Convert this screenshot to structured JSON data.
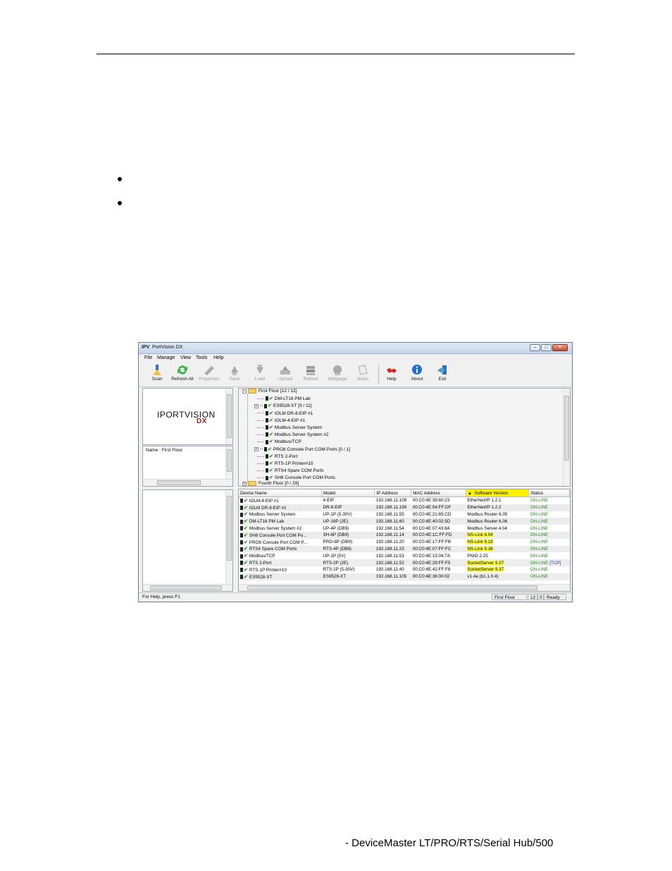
{
  "document": {
    "footer_text": "- DeviceMaster LT/PRO/RTS/Serial Hub/500"
  },
  "window": {
    "app_icon": "IPV",
    "title": "PortVision DX",
    "menu": [
      "File",
      "Manage",
      "View",
      "Tools",
      "Help"
    ],
    "toolbar": [
      {
        "label": "Scan",
        "icon": "scan-icon",
        "enabled": true
      },
      {
        "label": "Refresh All",
        "icon": "refresh-icon",
        "enabled": true
      },
      {
        "label": "Properties",
        "icon": "properties-icon",
        "enabled": false
      },
      {
        "label": "Save",
        "icon": "save-icon",
        "enabled": false
      },
      {
        "label": "Load",
        "icon": "load-icon",
        "enabled": false
      },
      {
        "label": "Upload",
        "icon": "upload-icon",
        "enabled": false
      },
      {
        "label": "Reboot",
        "icon": "reboot-icon",
        "enabled": false
      },
      {
        "label": "Webpage",
        "icon": "webpage-icon",
        "enabled": false
      },
      {
        "label": "Notes",
        "icon": "notes-icon",
        "enabled": false
      },
      {
        "label": "Help",
        "icon": "help-icon",
        "enabled": true
      },
      {
        "label": "About",
        "icon": "about-icon",
        "enabled": true
      },
      {
        "label": "Exit",
        "icon": "exit-icon",
        "enabled": true
      }
    ],
    "logo_text": "PORTVISION",
    "logo_prefix": "I",
    "logo_suffix": "DX",
    "properties_text": "Name : First Floor",
    "tree": {
      "root": "First Floor [12 / 12]",
      "children": [
        {
          "label": "DM-LT16 PM Lab",
          "expand": false
        },
        {
          "label": "ES9528-XT [9 / 11]",
          "expand": true
        },
        {
          "label": "IOLM DR-8-EIP #1",
          "expand": false
        },
        {
          "label": "IOLM-4-EIP #1",
          "expand": false
        },
        {
          "label": "Modbus Server System",
          "expand": false
        },
        {
          "label": "Modbus Server System #2",
          "expand": false
        },
        {
          "label": "Modbus/TCP",
          "expand": false
        },
        {
          "label": "PRO8 Console Port COM Ports [0 / 1]",
          "expand": true
        },
        {
          "label": "RTS 2-Port",
          "expand": false
        },
        {
          "label": "RTS-1P Printer#10",
          "expand": false
        },
        {
          "label": "RTS4 Spare COM Ports",
          "expand": false
        },
        {
          "label": "SH8 Console Port COM Ports",
          "expand": false
        }
      ],
      "next_root": "Fourth Floor [0 / 29]"
    },
    "grid": {
      "columns": [
        "Device Name",
        "Model",
        "IP Address",
        "MAC Address",
        "Software Version",
        "Status"
      ],
      "sorted_column": "Software Version",
      "rows": [
        {
          "name": "IOLM-4-EIP #1",
          "model": "4-EIP",
          "ip": "192.168.11.108",
          "mac": "00:C0:4E:39:60:23",
          "ver": "EtherNet/IP 1.2.1",
          "hl": false,
          "status": "ON-LINE",
          "extra": ""
        },
        {
          "name": "IOLM DR-8-EIP #1",
          "model": "DR-8-EIP",
          "ip": "192.168.11.199",
          "mac": "00:C0:4E:54:FF:DF",
          "ver": "EtherNet/IP 1.2.2",
          "hl": false,
          "status": "ON-LINE",
          "extra": ""
        },
        {
          "name": "Modbus Server System",
          "model": "UP-1P (5-30V)",
          "ip": "192.168.11.55",
          "mac": "00:C0:4E:21:65:CD",
          "ver": "Modbus Router 6.05",
          "hl": false,
          "status": "ON-LINE",
          "extra": ""
        },
        {
          "name": "DM-LT16 PM Lab",
          "model": "UP-16P (2E)",
          "ip": "192.168.11.60",
          "mac": "00:C0:4E:40:02:5D",
          "ver": "Modbus Router 6.06",
          "hl": false,
          "status": "ON-LINE",
          "extra": ""
        },
        {
          "name": "Modbus Server System #2",
          "model": "UP-4P (DB9)",
          "ip": "192.168.11.54",
          "mac": "00:C0:4E:07:43:84",
          "ver": "Modbus Server 4.04",
          "hl": false,
          "status": "ON-LINE",
          "extra": ""
        },
        {
          "name": "SH8 Console Port COM Po...",
          "model": "SH-8P (DB9)",
          "ip": "192.168.11.14",
          "mac": "00:C0:4E:1C:FF:FD",
          "ver": "NS-Link 8.04",
          "hl": true,
          "status": "ON-LINE",
          "extra": ""
        },
        {
          "name": "PRO8 Console Port COM P...",
          "model": "PRO-8P (DB9)",
          "ip": "192.168.11.20",
          "mac": "00:C0:4E:17:FF:FB",
          "ver": "NS-Link 9.18",
          "hl": true,
          "status": "ON-LINE",
          "extra": ""
        },
        {
          "name": "RTS4 Spare COM Ports",
          "model": "RTS-4P (DB9)",
          "ip": "192.168.11.23",
          "mac": "00:C0:4E:07:FF:FC",
          "ver": "NS-Link 9.36",
          "hl": true,
          "status": "ON-LINE",
          "extra": ""
        },
        {
          "name": "Modbus/TCP",
          "model": "UP-1P (5V)",
          "ip": "192.168.11.53",
          "mac": "00:C0:4E:15:04:7A",
          "ver": "PNIO 2.25",
          "hl": false,
          "status": "ON-LINE",
          "extra": ""
        },
        {
          "name": "RTS 2-Port",
          "model": "RTS-2P (2E)",
          "ip": "192.168.11.52",
          "mac": "00:C0:4E:29:FF:F5",
          "ver": "SocketServer 9.37",
          "hl": true,
          "status": "ON-LINE",
          "extra": "[TCP]"
        },
        {
          "name": "RTS-1P Printer#10",
          "model": "RTS-1P (5-30V)",
          "ip": "192.168.11.40",
          "mac": "00:C0:4E:42:FF:F8",
          "ver": "SocketServer 9.37",
          "hl": true,
          "status": "ON-LINE",
          "extra": ""
        },
        {
          "name": "ES9528-XT",
          "model": "ES9528-XT",
          "ip": "192.168.11.105",
          "mac": "00:C0:4E:36:00:02",
          "ver": "v1.4a  (b1.1.0.4)",
          "hl": false,
          "status": "ON-LINE",
          "extra": ""
        }
      ]
    },
    "statusbar": {
      "help": "For Help, press F1",
      "location": "First Floor",
      "count_a": "12",
      "count_b": "0",
      "state": "Ready"
    }
  }
}
